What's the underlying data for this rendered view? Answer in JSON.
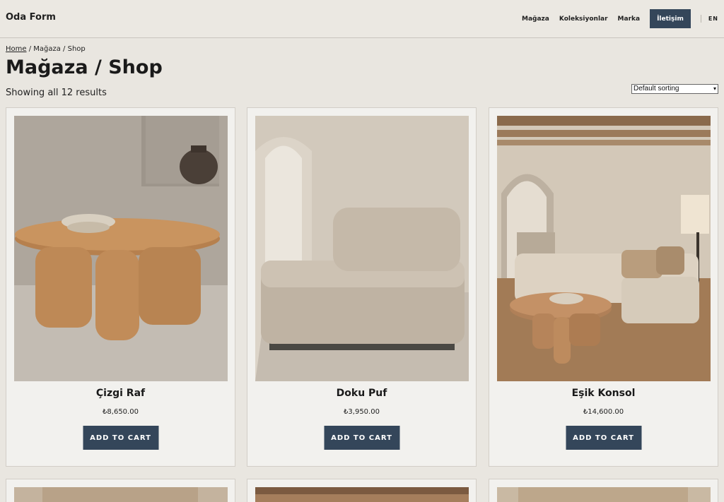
{
  "site": {
    "brand": "Oda Form",
    "nav": [
      "Mağaza",
      "Koleksiyonlar",
      "Marka"
    ],
    "cta": "İletişim",
    "lang": "EN"
  },
  "breadcrumb": {
    "home": "Home",
    "rest": " / Mağaza / Shop"
  },
  "page": {
    "title": "Mağaza / Shop",
    "result_count": "Showing all 12 results"
  },
  "sort": {
    "selected": "Default sorting"
  },
  "products": [
    {
      "name": "Çizgi Raf",
      "price": "₺8,650.00",
      "button": "ADD TO CART"
    },
    {
      "name": "Doku Puf",
      "price": "₺3,950.00",
      "button": "ADD TO CART"
    },
    {
      "name": "Eşik Konsol",
      "price": "₺14,600.00",
      "button": "ADD TO CART"
    }
  ]
}
